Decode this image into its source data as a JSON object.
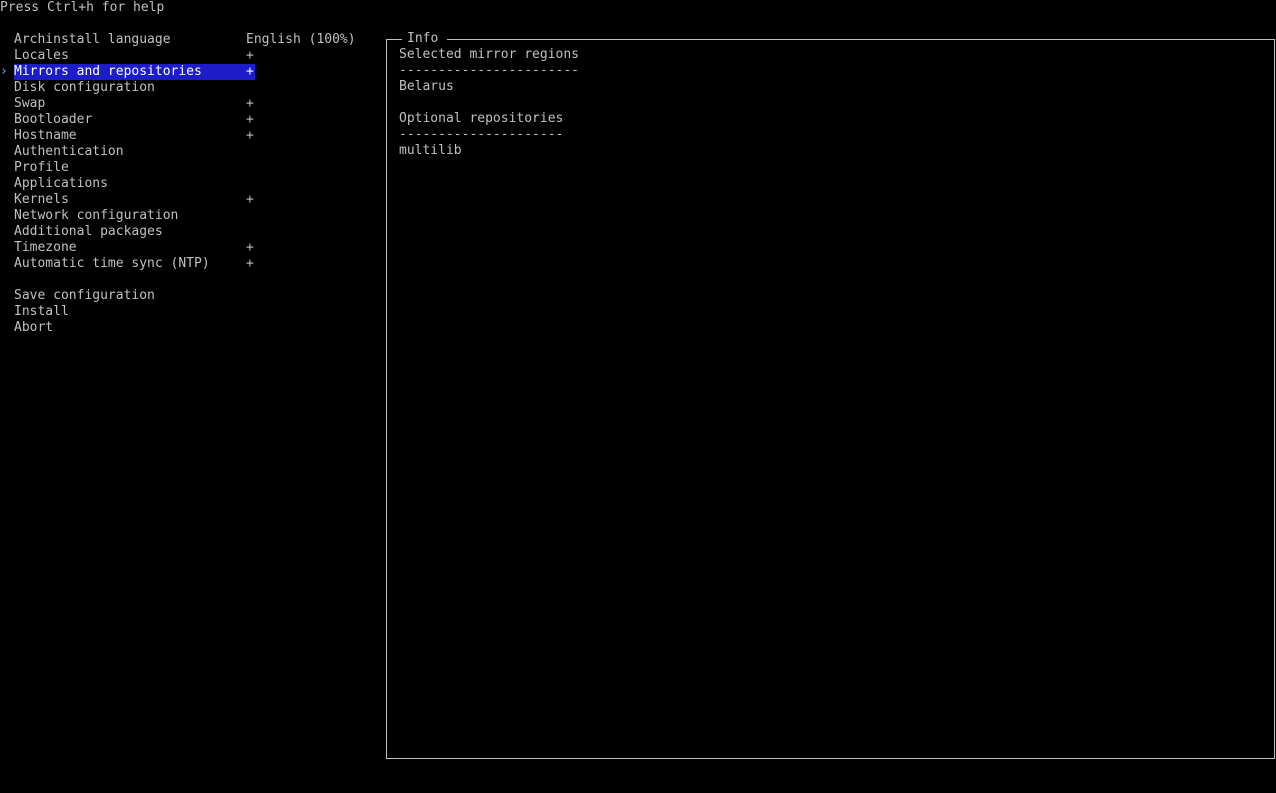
{
  "help": {
    "text": "Press Ctrl+h for help"
  },
  "menu": {
    "cursor": "›",
    "items": [
      {
        "label": "Archinstall language",
        "value": "English (100%)"
      },
      {
        "label": "Locales",
        "value": "+"
      },
      {
        "label": "Mirrors and repositories",
        "value": "+"
      },
      {
        "label": "Disk configuration",
        "value": ""
      },
      {
        "label": "Swap",
        "value": "+"
      },
      {
        "label": "Bootloader",
        "value": "+"
      },
      {
        "label": "Hostname",
        "value": "+"
      },
      {
        "label": "Authentication",
        "value": ""
      },
      {
        "label": "Profile",
        "value": ""
      },
      {
        "label": "Applications",
        "value": ""
      },
      {
        "label": "Kernels",
        "value": "+"
      },
      {
        "label": "Network configuration",
        "value": ""
      },
      {
        "label": "Additional packages",
        "value": ""
      },
      {
        "label": "Timezone",
        "value": "+"
      },
      {
        "label": "Automatic time sync (NTP)",
        "value": "+"
      }
    ],
    "actions": [
      {
        "label": "Save configuration"
      },
      {
        "label": "Install"
      },
      {
        "label": "Abort"
      }
    ]
  },
  "info": {
    "title": "Info",
    "mirror_heading": "Selected mirror regions",
    "mirror_rule": "-----------------------",
    "mirror_region": "Belarus",
    "repo_heading": "Optional repositories",
    "repo_rule": "---------------------",
    "repo_item": "multilib"
  },
  "colors": {
    "background": "#000000",
    "text": "#c0c0c0",
    "selection": "#1c1cc8",
    "cursor": "#5ab4ff"
  }
}
